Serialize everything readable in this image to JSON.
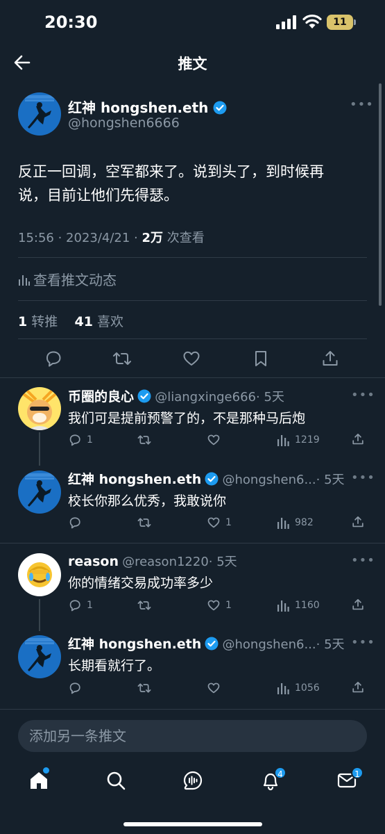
{
  "status_bar": {
    "time": "20:30",
    "battery": "11"
  },
  "header": {
    "title": "推文"
  },
  "tweet": {
    "author_name": "红神 hongshen.eth",
    "author_handle": "@hongshen6666",
    "text_line1": "反正一回调，空军都来了。说到头了，到时候再",
    "text_line2": "说，目前让他们先得瑟。",
    "meta_time": "15:56 · 2023/4/21 · ",
    "meta_views": "2万",
    "meta_views_label": " 次查看",
    "activity_label": "查看推文动态",
    "retweets_count": "1",
    "retweets_label": "转推",
    "likes_count": "41",
    "likes_label": "喜欢"
  },
  "replies": [
    {
      "name": "币圈的良心",
      "handle": "@liangxinge666",
      "time": "· 5天",
      "text": "我们可是提前预警了的，不是那种马后炮",
      "replies": "1",
      "retweets": "",
      "likes": "",
      "views": "1219"
    },
    {
      "name": "红神 hongshen.eth",
      "handle": "@hongshen6...",
      "time": "· 5天",
      "text": "校长你那么优秀，我敢说你",
      "replies": "",
      "retweets": "",
      "likes": "1",
      "views": "982"
    },
    {
      "name": "reason",
      "handle": "@reason1220",
      "time": "· 5天",
      "text": "你的情绪交易成功率多少",
      "replies": "1",
      "retweets": "",
      "likes": "1",
      "views": "1160"
    },
    {
      "name": "红神 hongshen.eth",
      "handle": "@hongshen6...",
      "time": "· 5天",
      "text": "长期看就行了。",
      "replies": "",
      "retweets": "",
      "likes": "",
      "views": "1056"
    }
  ],
  "compose": {
    "placeholder": "添加另一条推文"
  },
  "tabbar": {
    "notifications_badge": "4",
    "messages_badge": "1"
  },
  "colors": {
    "accent": "#1d9bf0",
    "background": "#15202b",
    "muted": "#8b98a5"
  }
}
